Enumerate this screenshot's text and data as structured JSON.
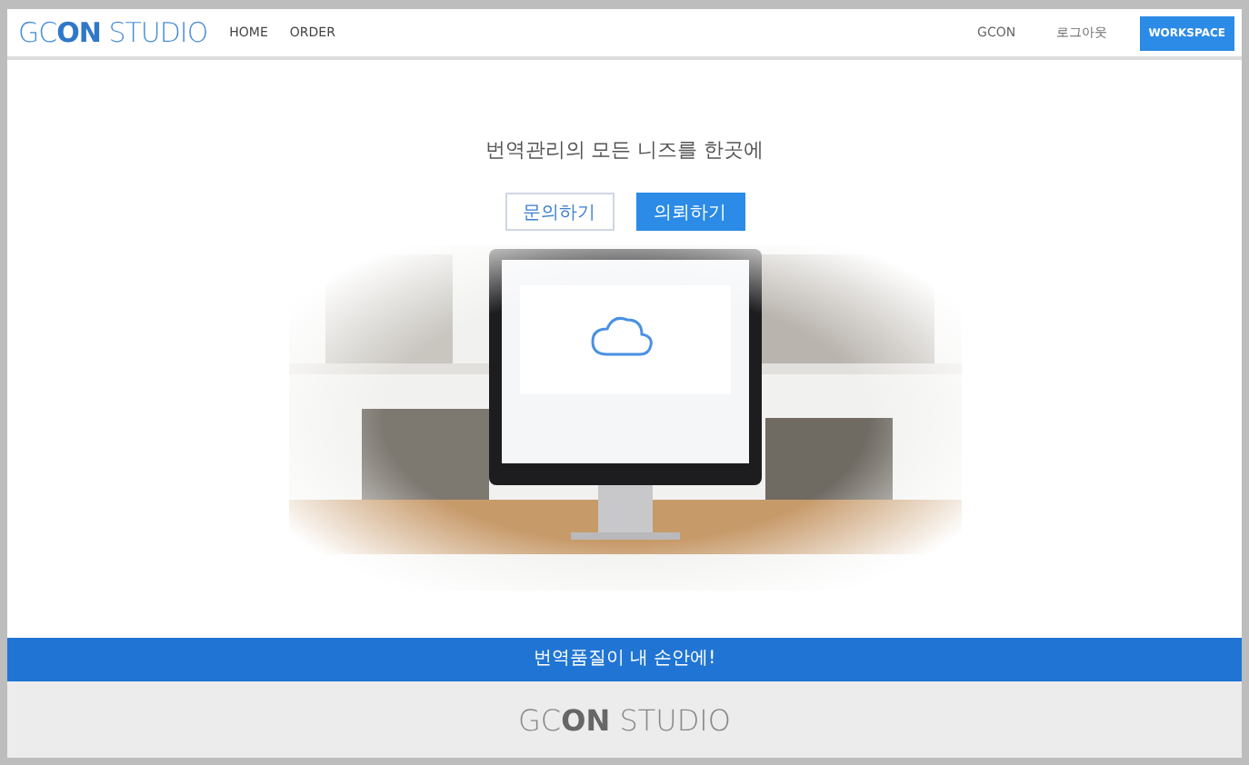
{
  "header": {
    "logo": "GC**ON** STUDIO",
    "nav": [
      "HOME",
      "ORDER"
    ],
    "right_links": [
      "GCON",
      "로그아웃"
    ],
    "workspace_button": "WORKSPACE"
  },
  "hero": {
    "headline": "번역관리의 모든 니즈를 한곳에",
    "buttons": [
      {
        "label": "문의하기",
        "kind": "outline"
      },
      {
        "label": "의뢰하기",
        "kind": "primary"
      }
    ]
  },
  "banner": {
    "text": "번역품질이 내 손안에!"
  },
  "footer": {
    "logo": "GC**ON** STUDIO"
  }
}
